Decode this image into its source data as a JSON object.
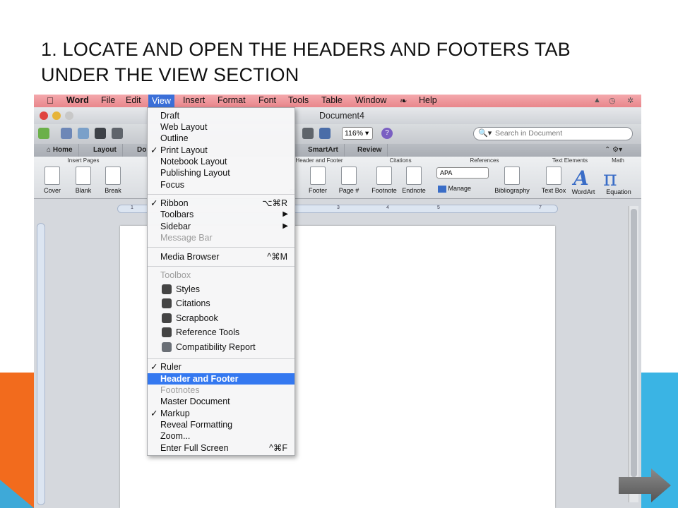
{
  "slide": {
    "title_line1": "1. LOCATE AND OPEN THE HEADERS AND FOOTERS TAB",
    "title_line2": "UNDER THE VIEW SECTION"
  },
  "menubar": {
    "app": "Word",
    "items": [
      "File",
      "Edit",
      "View",
      "Insert",
      "Format",
      "Font",
      "Tools",
      "Table",
      "Window",
      "Help"
    ],
    "active": "View"
  },
  "window": {
    "title": "Document4",
    "zoom": "116%",
    "search_placeholder": "Search in Document"
  },
  "tabs": [
    "Home",
    "Layout",
    "Do",
    "SmartArt",
    "Review"
  ],
  "ribbon": {
    "groups": {
      "insert_pages": "Insert Pages",
      "header_footer": "Header and Footer",
      "citations": "Citations",
      "references": "References",
      "text_elements": "Text Elements",
      "math": "Math"
    },
    "buttons": {
      "cover": "Cover",
      "blank": "Blank",
      "break": "Break",
      "header_partial": "er",
      "footer": "Footer",
      "page_num": "Page #",
      "footnote": "Footnote",
      "endnote": "Endnote",
      "apa": "APA",
      "manage": "Manage",
      "bibliography": "Bibliography",
      "text_box": "Text Box",
      "wordart": "WordArt",
      "equation": "Equation"
    }
  },
  "ruler_marks": [
    "1",
    "3",
    "4",
    "5",
    "7"
  ],
  "view_menu": {
    "group1": [
      {
        "label": "Draft",
        "checked": false
      },
      {
        "label": "Web Layout",
        "checked": false
      },
      {
        "label": "Outline",
        "checked": false
      },
      {
        "label": "Print Layout",
        "checked": true
      },
      {
        "label": "Notebook Layout",
        "checked": false
      },
      {
        "label": "Publishing Layout",
        "checked": false
      },
      {
        "label": "Focus",
        "checked": false
      }
    ],
    "group2": [
      {
        "label": "Ribbon",
        "checked": true,
        "shortcut": "⌥⌘R"
      },
      {
        "label": "Toolbars",
        "submenu": true
      },
      {
        "label": "Sidebar",
        "submenu": true
      },
      {
        "label": "Message Bar",
        "disabled": true
      }
    ],
    "media_browser": {
      "label": "Media Browser",
      "shortcut": "^⌘M"
    },
    "toolbox": {
      "heading": "Toolbox",
      "items": [
        "Styles",
        "Citations",
        "Scrapbook",
        "Reference Tools",
        "Compatibility Report"
      ]
    },
    "group4": [
      {
        "label": "Ruler",
        "checked": true
      },
      {
        "label": "Header and Footer",
        "selected": true
      },
      {
        "label": "Footnotes",
        "disabled": true
      },
      {
        "label": "Master Document"
      },
      {
        "label": "Markup",
        "checked": true
      },
      {
        "label": "Reveal Formatting"
      },
      {
        "label": "Zoom..."
      },
      {
        "label": "Enter Full Screen",
        "shortcut": "^⌘F"
      }
    ]
  },
  "colors": {
    "menubar": "#e8868b",
    "selection": "#3478f0",
    "deco_orange": "#f26b1d",
    "deco_blue": "#3ab4e4"
  }
}
